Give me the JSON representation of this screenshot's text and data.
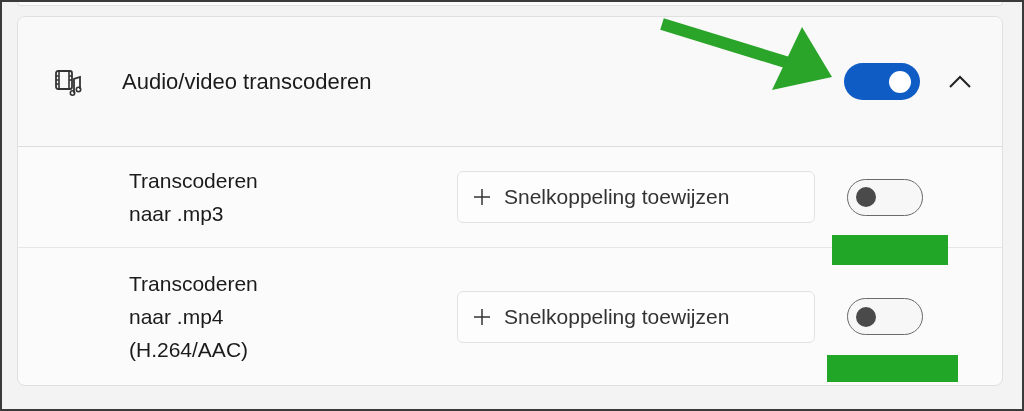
{
  "group": {
    "title": "Audio/video transcoderen",
    "on": true,
    "expanded": true,
    "items": [
      {
        "label": "Transcoderen\nnaar .mp3",
        "shortcut_button": "Snelkoppeling toewijzen",
        "on": false
      },
      {
        "label": "Transcoderen\nnaar .mp4\n(H.264/AAC)",
        "shortcut_button": "Snelkoppeling toewijzen",
        "on": false
      }
    ]
  }
}
